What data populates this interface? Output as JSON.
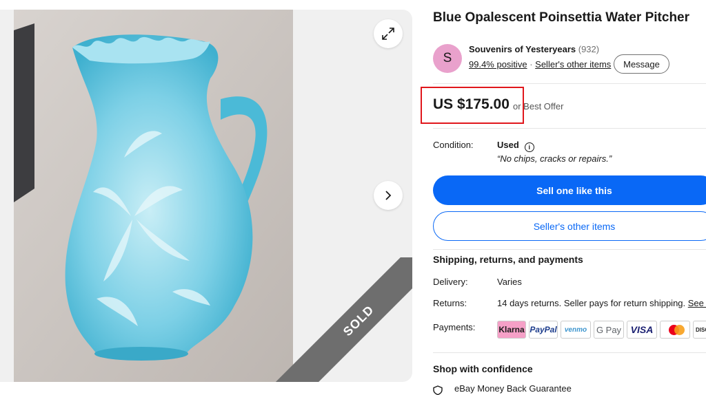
{
  "listing": {
    "title": "Blue Opalescent Poinsettia Water Pitcher",
    "sold_badge": "SOLD"
  },
  "seller": {
    "avatar_letter": "S",
    "name": "Souvenirs of Yesteryears",
    "feedback_count": "(932)",
    "positive": "99.4% positive",
    "other_items_link": "Seller's other items",
    "message_button": "Message"
  },
  "price": {
    "amount": "US $175.00",
    "best_offer": "or Best Offer"
  },
  "condition": {
    "label": "Condition:",
    "value": "Used",
    "note": "“No chips, cracks or repairs.”"
  },
  "actions": {
    "sell_one": "Sell one like this",
    "seller_other_items": "Seller's other items"
  },
  "shipping": {
    "heading": "Shipping, returns, and payments",
    "delivery_label": "Delivery:",
    "delivery_value": "Varies",
    "returns_label": "Returns:",
    "returns_value": "14 days returns. Seller pays for return shipping.",
    "returns_link": "See de",
    "payments_label": "Payments:",
    "payment_methods": [
      "Klarna",
      "PayPal",
      "venmo",
      "G Pay",
      "VISA",
      "mastercard",
      "DISCOVER"
    ]
  },
  "confidence": {
    "heading": "Shop with confidence",
    "guarantee": "eBay Money Back Guarantee"
  },
  "colors": {
    "primary_blue": "#0968f6",
    "highlight_red": "#e0161b",
    "gallery_bg": "#f0f0f0"
  }
}
